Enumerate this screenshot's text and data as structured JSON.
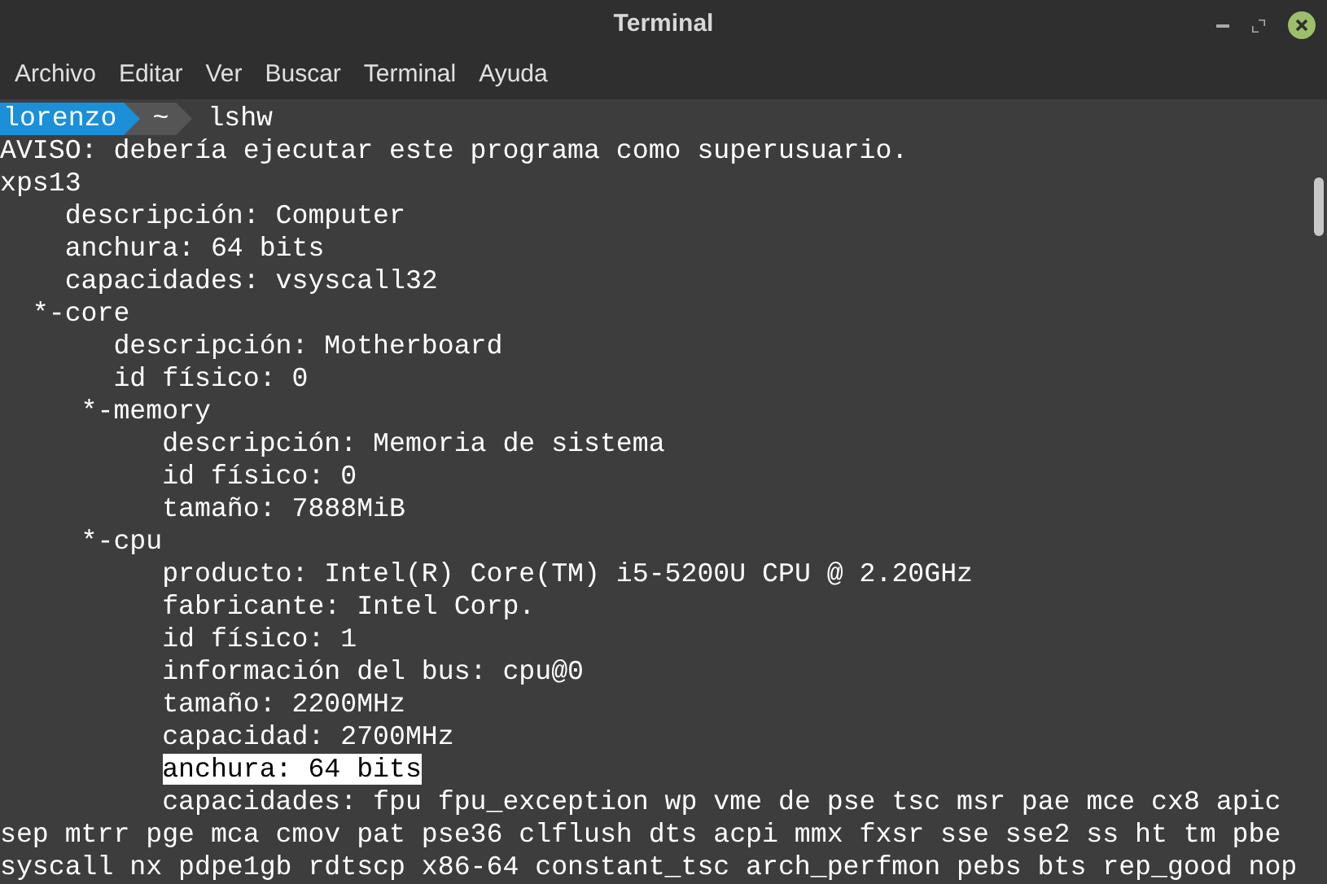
{
  "window": {
    "title": "Terminal"
  },
  "menu": [
    "Archivo",
    "Editar",
    "Ver",
    "Buscar",
    "Terminal",
    "Ayuda"
  ],
  "prompt": {
    "user": "lorenzo",
    "path": "~",
    "command": "lshw"
  },
  "lines": [
    {
      "text": "AVISO: debería ejecutar este programa como superusuario.",
      "selected": false
    },
    {
      "text": "xps13",
      "selected": false
    },
    {
      "text": "    descripción: Computer",
      "selected": false
    },
    {
      "text": "    anchura: 64 bits",
      "selected": false
    },
    {
      "text": "    capacidades: vsyscall32",
      "selected": false
    },
    {
      "text": "  *-core",
      "selected": false
    },
    {
      "text": "       descripción: Motherboard",
      "selected": false
    },
    {
      "text": "       id físico: 0",
      "selected": false
    },
    {
      "text": "     *-memory",
      "selected": false
    },
    {
      "text": "          descripción: Memoria de sistema",
      "selected": false
    },
    {
      "text": "          id físico: 0",
      "selected": false
    },
    {
      "text": "          tamaño: 7888MiB",
      "selected": false
    },
    {
      "text": "     *-cpu",
      "selected": false
    },
    {
      "text": "          producto: Intel(R) Core(TM) i5-5200U CPU @ 2.20GHz",
      "selected": false
    },
    {
      "text": "          fabricante: Intel Corp.",
      "selected": false
    },
    {
      "text": "          id físico: 1",
      "selected": false
    },
    {
      "text": "          información del bus: cpu@0",
      "selected": false
    },
    {
      "text": "          tamaño: 2200MHz",
      "selected": false
    },
    {
      "text": "          capacidad: 2700MHz",
      "selected": false
    },
    {
      "text": "          anchura: 64 bits",
      "selected": true
    },
    {
      "text": "          capacidades: fpu fpu_exception wp vme de pse tsc msr pae mce cx8 apic",
      "selected": false
    },
    {
      "text": "sep mtrr pge mca cmov pat pse36 clflush dts acpi mmx fxsr sse sse2 ss ht tm pbe",
      "selected": false
    },
    {
      "text": "syscall nx pdpe1gb rdtscp x86-64 constant_tsc arch_perfmon pebs bts rep_good nop",
      "selected": false
    }
  ]
}
